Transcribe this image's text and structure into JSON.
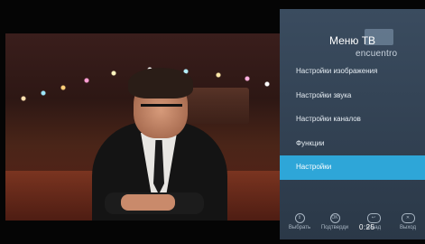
{
  "menu": {
    "title": "Меню ТВ",
    "channel_logo_text": "encuentro",
    "items": [
      {
        "label": "Настройки изображения"
      },
      {
        "label": "Настройки звука"
      },
      {
        "label": "Настройки каналов"
      },
      {
        "label": "Функции"
      },
      {
        "label": "Настройки",
        "selected": true
      }
    ]
  },
  "hints": [
    {
      "icon": "select-icon",
      "label": "Выбрать"
    },
    {
      "icon": "ok-icon",
      "label": "Подтверди"
    },
    {
      "icon": "back-icon",
      "label": "назад"
    },
    {
      "icon": "exit-icon",
      "label": "Выход"
    }
  ],
  "timer": "0:25",
  "colors": {
    "panel": "#3c4e62",
    "selected": "#2ea6d8"
  }
}
